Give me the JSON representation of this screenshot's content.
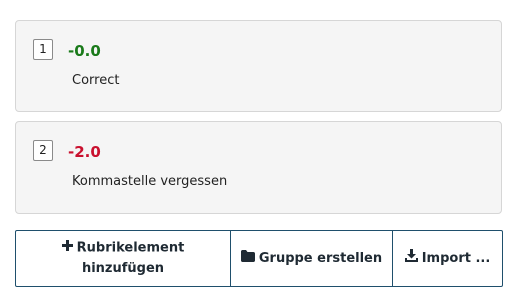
{
  "criteria": [
    {
      "number": "1",
      "points": "-0.0",
      "points_color": "#1a7a1a",
      "description": "Correct"
    },
    {
      "number": "2",
      "points": "-2.0",
      "points_color": "#c9102e",
      "description": "Kommastelle vergessen"
    }
  ],
  "toolbar": {
    "add_label_line1": "Rubrikelement",
    "add_label_line2": "hinzufügen",
    "group_label": "Gruppe erstellen",
    "import_label": "Import ..."
  },
  "icons": {
    "add": "plus-icon",
    "group": "folder-icon",
    "import": "download-icon"
  }
}
